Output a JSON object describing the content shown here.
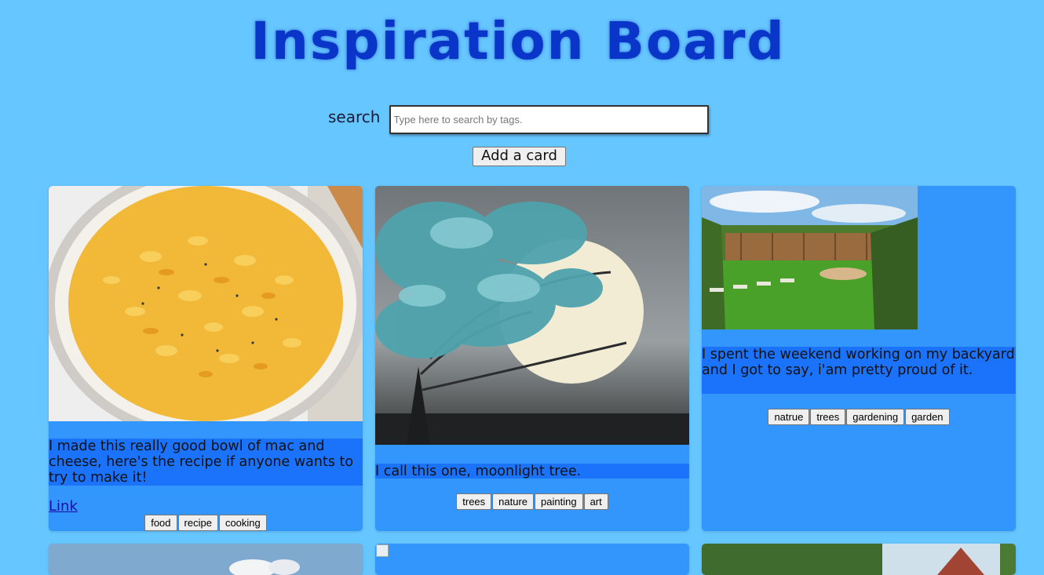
{
  "header": {
    "title": "Inspiration Board"
  },
  "search": {
    "label": "search",
    "placeholder": "Type here to search by tags.",
    "value": ""
  },
  "add_card": {
    "label": "Add a card"
  },
  "cards": [
    {
      "description": "I made this really good bowl of mac and cheese, here's the recipe if anyone wants to try to make it!",
      "link_label": "Link",
      "tags": [
        "food",
        "recipe",
        "cooking"
      ],
      "image": "mac-and-cheese-photo"
    },
    {
      "description": "I call this one, moonlight tree.",
      "tags": [
        "trees",
        "nature",
        "painting",
        "art"
      ],
      "image": "moonlight-tree-painting"
    },
    {
      "description": "I spent the weekend working on my backyard and I got to say, i'am pretty proud of it.",
      "tags": [
        "natrue",
        "trees",
        "gardening",
        "garden"
      ],
      "image": "backyard-garden-photo"
    }
  ],
  "colors": {
    "page_bg": "#66c6ff",
    "card_bg": "#3396fd",
    "description_bg": "#1c73fb",
    "title": "#0a35c9"
  }
}
